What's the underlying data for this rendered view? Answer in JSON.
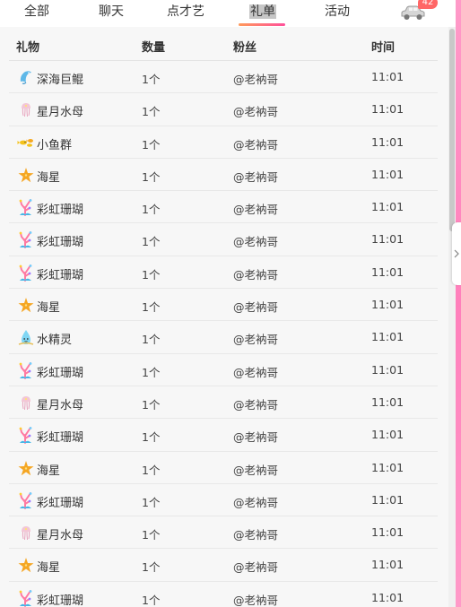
{
  "tabs": [
    {
      "label": "全部",
      "active": false
    },
    {
      "label": "聊天",
      "active": false
    },
    {
      "label": "点才艺",
      "active": false
    },
    {
      "label": "礼单",
      "active": true
    },
    {
      "label": "活动",
      "active": false
    }
  ],
  "car_badge": "42",
  "colors": {
    "accent_gradient": [
      "#ff9a5a",
      "#ff4f9a"
    ],
    "badge": "#ff6666",
    "side_strip": "#ff8fc4"
  },
  "table": {
    "headers": {
      "gift": "礼物",
      "qty": "数量",
      "fan": "粉丝",
      "time": "时间"
    },
    "rows": [
      {
        "icon": "dolphin-icon",
        "gift": "深海巨鲲",
        "qty": "1个",
        "fan": "@老衲哥",
        "time": "11:01"
      },
      {
        "icon": "jellyfish-icon",
        "gift": "星月水母",
        "qty": "1个",
        "fan": "@老衲哥",
        "time": "11:01"
      },
      {
        "icon": "fish-school-icon",
        "gift": "小鱼群",
        "qty": "1个",
        "fan": "@老衲哥",
        "time": "11:01"
      },
      {
        "icon": "starfish-icon",
        "gift": "海星",
        "qty": "1个",
        "fan": "@老衲哥",
        "time": "11:01"
      },
      {
        "icon": "coral-icon",
        "gift": "彩虹珊瑚",
        "qty": "1个",
        "fan": "@老衲哥",
        "time": "11:01"
      },
      {
        "icon": "coral-icon",
        "gift": "彩虹珊瑚",
        "qty": "1个",
        "fan": "@老衲哥",
        "time": "11:01"
      },
      {
        "icon": "coral-icon",
        "gift": "彩虹珊瑚",
        "qty": "1个",
        "fan": "@老衲哥",
        "time": "11:01"
      },
      {
        "icon": "starfish-icon",
        "gift": "海星",
        "qty": "1个",
        "fan": "@老衲哥",
        "time": "11:01"
      },
      {
        "icon": "water-sprite-icon",
        "gift": "水精灵",
        "qty": "1个",
        "fan": "@老衲哥",
        "time": "11:01"
      },
      {
        "icon": "coral-icon",
        "gift": "彩虹珊瑚",
        "qty": "1个",
        "fan": "@老衲哥",
        "time": "11:01"
      },
      {
        "icon": "jellyfish-icon",
        "gift": "星月水母",
        "qty": "1个",
        "fan": "@老衲哥",
        "time": "11:01"
      },
      {
        "icon": "coral-icon",
        "gift": "彩虹珊瑚",
        "qty": "1个",
        "fan": "@老衲哥",
        "time": "11:01"
      },
      {
        "icon": "starfish-icon",
        "gift": "海星",
        "qty": "1个",
        "fan": "@老衲哥",
        "time": "11:01"
      },
      {
        "icon": "coral-icon",
        "gift": "彩虹珊瑚",
        "qty": "1个",
        "fan": "@老衲哥",
        "time": "11:01"
      },
      {
        "icon": "jellyfish-icon",
        "gift": "星月水母",
        "qty": "1个",
        "fan": "@老衲哥",
        "time": "11:01"
      },
      {
        "icon": "starfish-icon",
        "gift": "海星",
        "qty": "1个",
        "fan": "@老衲哥",
        "time": "11:01"
      },
      {
        "icon": "coral-icon",
        "gift": "彩虹珊瑚",
        "qty": "1个",
        "fan": "@老衲哥",
        "time": "11:01"
      }
    ]
  }
}
